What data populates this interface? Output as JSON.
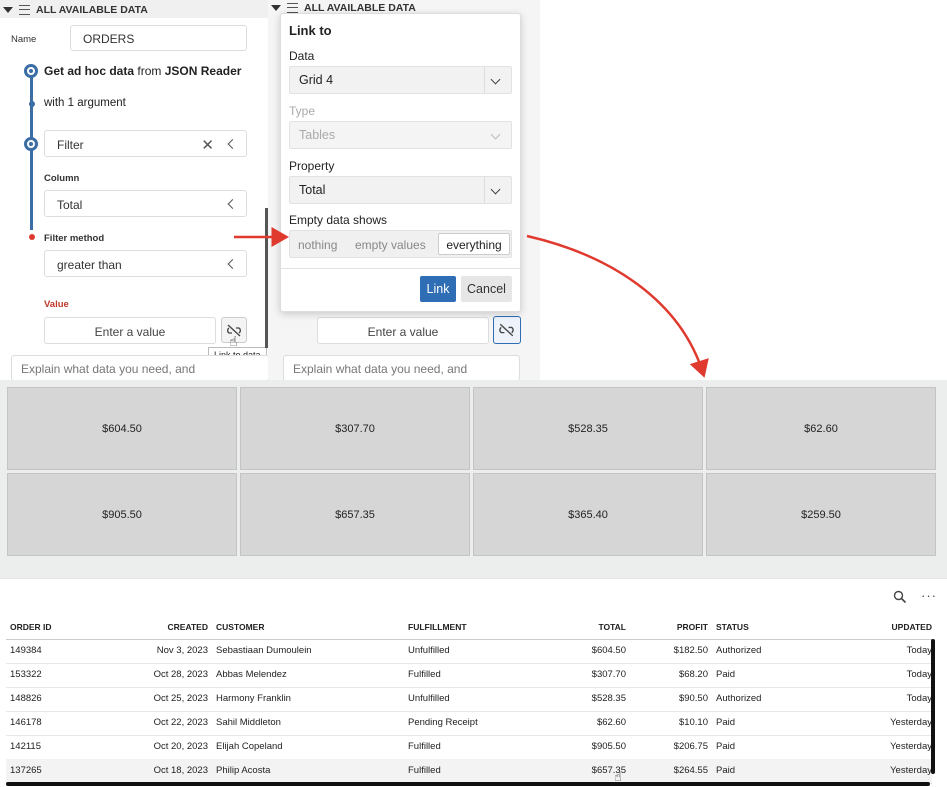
{
  "left_panel": {
    "header": "ALL AVAILABLE DATA",
    "name_label": "Name",
    "name_value": "ORDERS",
    "step1_bold": "Get ad hoc data",
    "step1_from": "from",
    "step1_source": "JSON Reader",
    "step1_arg": "with 1 argument",
    "filter_label": "Filter",
    "column_label": "Column",
    "column_value": "Total",
    "filter_method_label": "Filter method",
    "filter_method_value": "greater than",
    "value_label": "Value",
    "value_placeholder": "Enter a value",
    "tooltip": "Link to data",
    "ai_placeholder": "Explain what data you need, and"
  },
  "mid_panel": {
    "header": "ALL AVAILABLE DATA",
    "value_placeholder": "Enter a value",
    "ai_placeholder": "Explain what data you need, and"
  },
  "dialog": {
    "title": "Link to",
    "data_label": "Data",
    "data_value": "Grid 4",
    "type_label": "Type",
    "type_value": "Tables",
    "property_label": "Property",
    "property_value": "Total",
    "empty_label": "Empty data shows",
    "empty_options": [
      "nothing",
      "empty values",
      "everything"
    ],
    "empty_selected": "everything",
    "link_button": "Link",
    "cancel_button": "Cancel"
  },
  "grid_tiles": [
    "$604.50",
    "$307.70",
    "$528.35",
    "$62.60",
    "$905.50",
    "$657.35",
    "$365.40",
    "$259.50"
  ],
  "table": {
    "headers": [
      "ORDER ID",
      "CREATED",
      "CUSTOMER",
      "FULFILLMENT",
      "TOTAL",
      "PROFIT",
      "STATUS",
      "UPDATED"
    ],
    "rows": [
      [
        "149384",
        "Nov 3, 2023",
        "Sebastiaan Dumoulein",
        "Unfulfilled",
        "$604.50",
        "$182.50",
        "Authorized",
        "Today"
      ],
      [
        "153322",
        "Oct 28, 2023",
        "Abbas Melendez",
        "Fulfilled",
        "$307.70",
        "$68.20",
        "Paid",
        "Today"
      ],
      [
        "148826",
        "Oct 25, 2023",
        "Harmony Franklin",
        "Unfulfilled",
        "$528.35",
        "$90.50",
        "Authorized",
        "Today"
      ],
      [
        "146178",
        "Oct 22, 2023",
        "Sahil Middleton",
        "Pending Receipt",
        "$62.60",
        "$10.10",
        "Paid",
        "Yesterday"
      ],
      [
        "142115",
        "Oct 20, 2023",
        "Elijah Copeland",
        "Fulfilled",
        "$905.50",
        "$206.75",
        "Paid",
        "Yesterday"
      ],
      [
        "137265",
        "Oct 18, 2023",
        "Philip Acosta",
        "Fulfilled",
        "$657.35",
        "$264.55",
        "Paid",
        "Yesterday"
      ]
    ]
  },
  "colors": {
    "accent": "#2f6db5",
    "arrow": "#e03a2f",
    "ring": "#3b6ea5",
    "value_label": "#c0392b"
  }
}
